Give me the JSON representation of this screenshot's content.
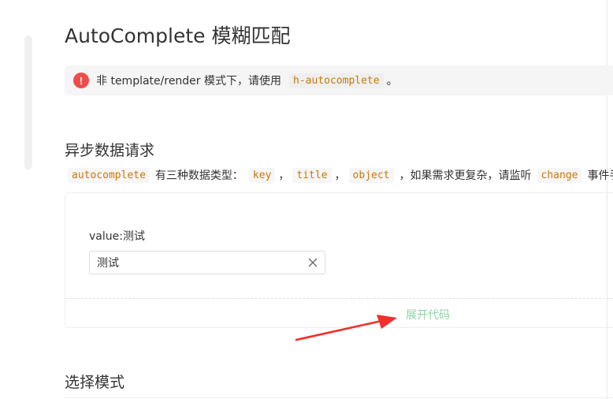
{
  "page": {
    "title": "AutoComplete 模糊匹配"
  },
  "notice": {
    "icon": "error-icon",
    "text_before": "非 template/render 模式下，请使用",
    "code": "h-autocomplete",
    "text_after": "。"
  },
  "section_async": {
    "title": "异步数据请求",
    "desc": {
      "code_autocomplete": "autocomplete",
      "text_types": "有三种数据类型：",
      "code_key": "key",
      "sep1": "，",
      "code_title": "title",
      "sep2": "，",
      "code_object": "object",
      "text_more": "，如果需求更复杂，请监听",
      "code_change": "change",
      "text_event": "事件手"
    },
    "demo": {
      "value_label": "value:测试",
      "input_value": "测试",
      "clear_icon": "close-icon",
      "expand_code": "展开代码"
    }
  },
  "section_select": {
    "title": "选择模式"
  },
  "colors": {
    "error": "#ef4c4c",
    "code_text": "#c7780a",
    "expand_link": "#8fd4a8",
    "annotation_arrow": "#f0302a"
  }
}
